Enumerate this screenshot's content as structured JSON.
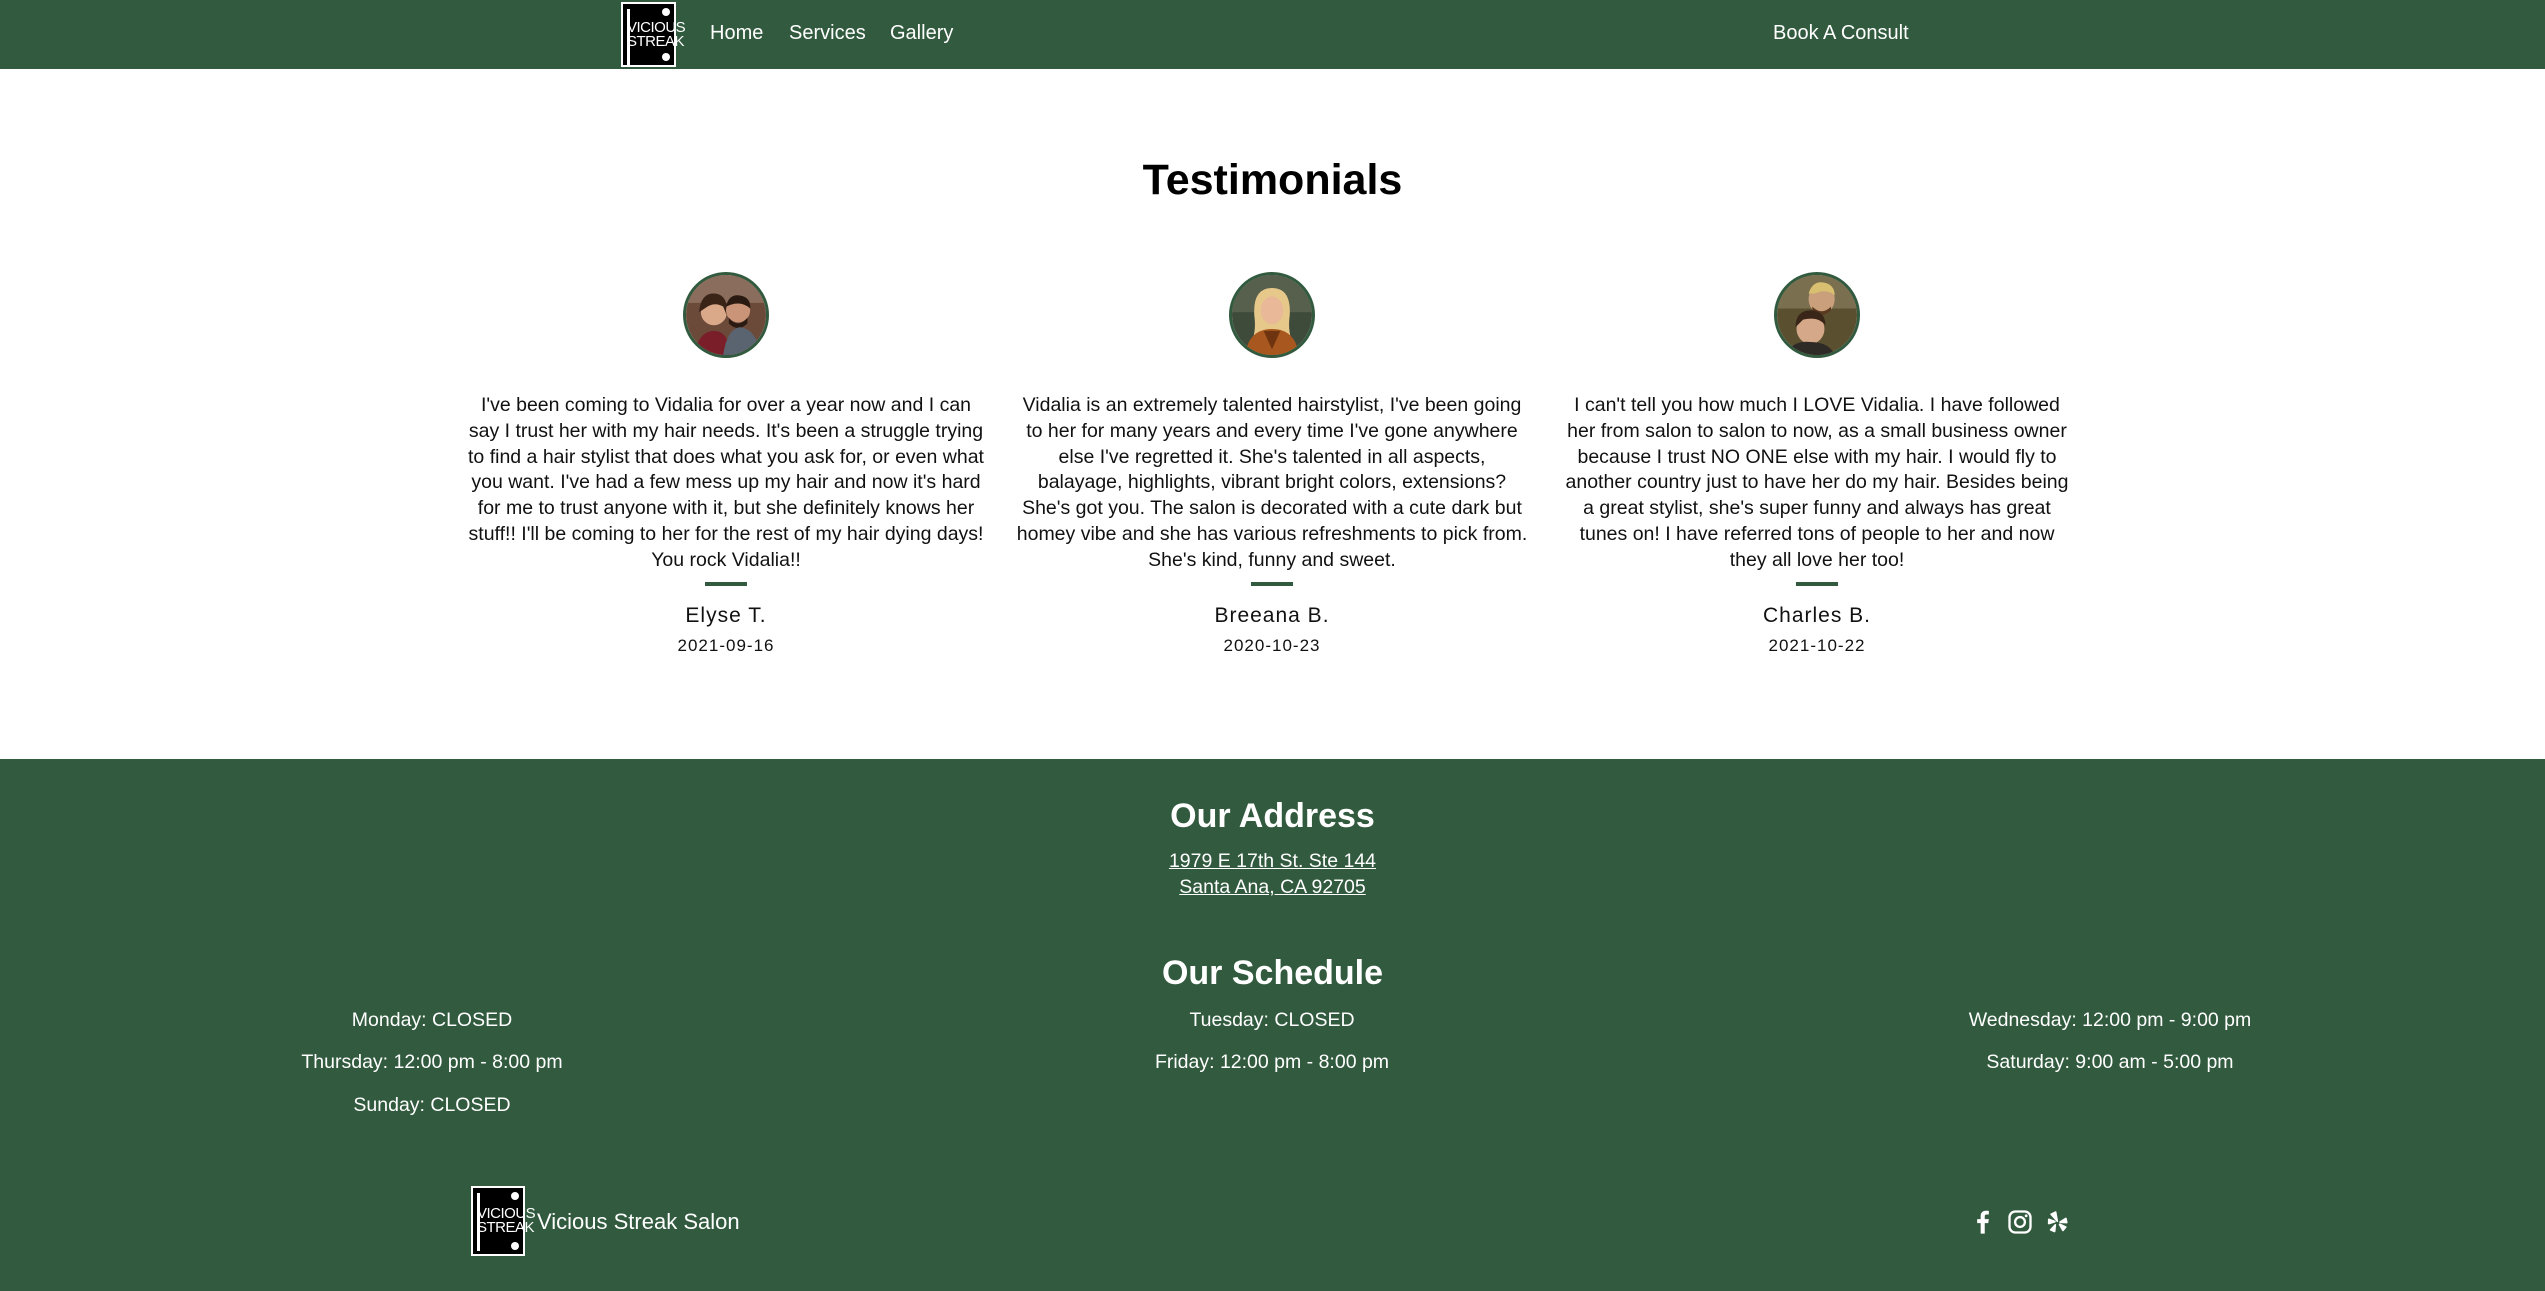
{
  "header": {
    "logo_text": "VICIOUS STREAK",
    "nav": [
      {
        "label": "Home"
      },
      {
        "label": "Services"
      },
      {
        "label": "Gallery"
      }
    ],
    "cta_label": "Book A Consult"
  },
  "testimonials": {
    "title": "Testimonials",
    "items": [
      {
        "quote": "I've been coming to Vidalia for over a year now and I can say I trust her with my hair needs. It's been a struggle trying to find a hair stylist that does what you ask for, or even what you want. I've had a few mess up my hair and now it's hard for me to trust anyone with it, but she definitely knows her stuff!! I'll be coming to her for the rest of my hair dying days! You rock Vidalia!!",
        "name": "Elyse T.",
        "date": "2021-09-16"
      },
      {
        "quote": "Vidalia is an extremely talented hairstylist, I've been going to her for many years and every time I've gone anywhere else I've regretted it. She's talented in all aspects, balayage, highlights, vibrant bright colors, extensions? She's got you. The salon is decorated with a cute dark but homey vibe and she has various refreshments to pick from. She's kind, funny and sweet.",
        "name": "Breeana B.",
        "date": "2020-10-23"
      },
      {
        "quote": "I can't tell you how much I LOVE Vidalia. I have followed her from salon to salon to now, as a small business owner because I trust NO ONE else with my hair. I would fly to another country just to have her do my hair. Besides being a great stylist, she's super funny and always has great tunes on! I have referred tons of people to her and now they all love her too!",
        "name": "Charles B.",
        "date": "2021-10-22"
      }
    ]
  },
  "footer": {
    "address_title": "Our Address",
    "address_line1": "1979 E 17th St. Ste 144",
    "address_line2": "Santa Ana, CA 92705",
    "schedule_title": "Our Schedule",
    "schedule": [
      "Monday: CLOSED",
      "Tuesday: CLOSED",
      "Wednesday: 12:00 pm - 9:00 pm",
      "Thursday: 12:00 pm - 8:00 pm",
      "Friday: 12:00 pm - 8:00 pm",
      "Saturday: 9:00 am - 5:00 pm",
      "Sunday: CLOSED"
    ],
    "brand_name": "Vicious Streak Salon",
    "social_icons": [
      "facebook-icon",
      "instagram-icon",
      "yelp-icon"
    ]
  },
  "colors": {
    "brand_green": "#315a3e",
    "text": "#111111",
    "background": "#ffffff"
  }
}
